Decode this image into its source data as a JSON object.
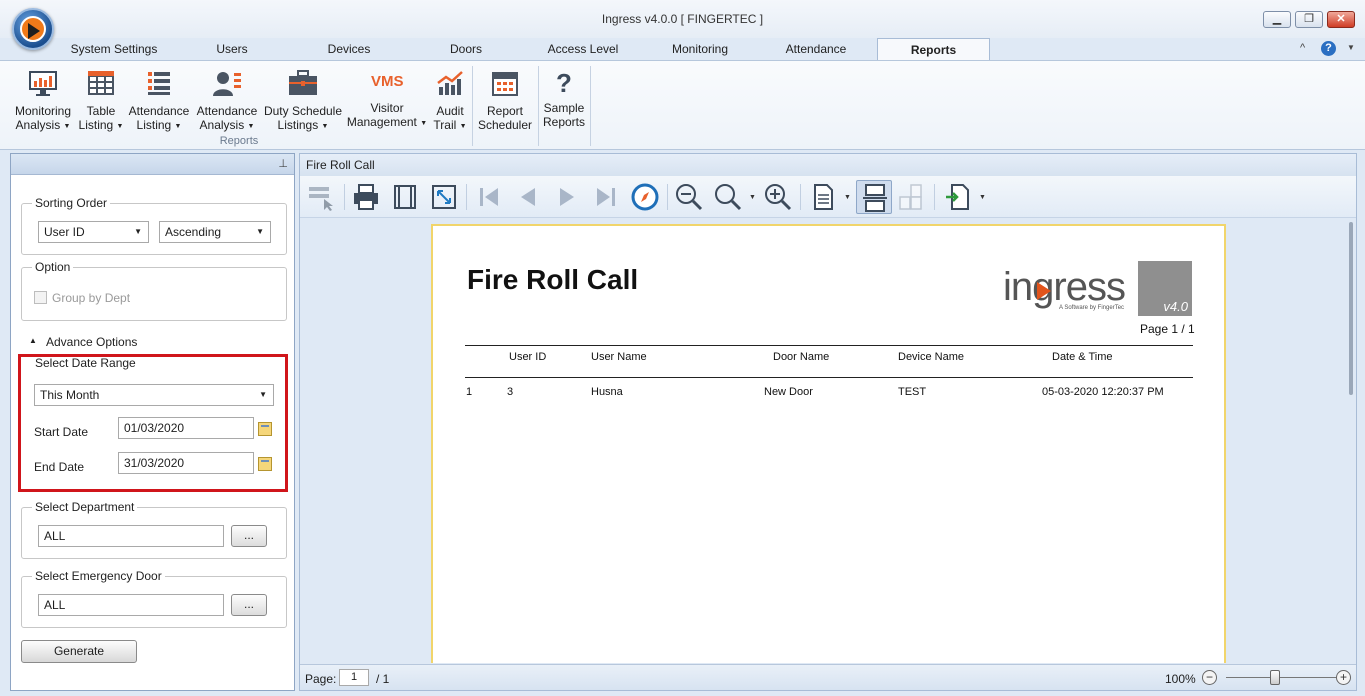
{
  "window": {
    "title": "Ingress v4.0.0 [ FINGERTEC ]",
    "minimize": "▁",
    "restore": "❐",
    "close": "✕"
  },
  "tabs": [
    "System Settings",
    "Users",
    "Devices",
    "Doors",
    "Access Level",
    "Monitoring",
    "Attendance",
    "Reports"
  ],
  "active_tab": "Reports",
  "help": {
    "collapse": "^",
    "help": "?",
    "more": "▼"
  },
  "ribbon": {
    "group_label": "Reports",
    "buttons": [
      {
        "line1": "Monitoring",
        "line2": "Analysis",
        "dropdown": true,
        "icon": "monitor-chart-icon"
      },
      {
        "line1": "Table",
        "line2": "Listing",
        "dropdown": true,
        "icon": "table-icon"
      },
      {
        "line1": "Attendance",
        "line2": "Listing",
        "dropdown": true,
        "icon": "list-icon"
      },
      {
        "line1": "Attendance",
        "line2": "Analysis",
        "dropdown": true,
        "icon": "user-analysis-icon"
      },
      {
        "line1": "Duty Schedule",
        "line2": "Listings",
        "dropdown": true,
        "icon": "briefcase-icon"
      },
      {
        "line1": "Visitor",
        "line2": "Management",
        "dropdown": true,
        "icon": "vms-icon",
        "icon_text": "VMS"
      },
      {
        "line1": "Audit",
        "line2": "Trail",
        "dropdown": true,
        "icon": "trend-chart-icon"
      },
      {
        "line1": "Report",
        "line2": "Scheduler",
        "dropdown": false,
        "icon": "calendar-icon"
      },
      {
        "line1": "Sample",
        "line2": "Reports",
        "dropdown": false,
        "icon": "question-icon",
        "icon_text": "?"
      }
    ]
  },
  "left_panel": {
    "pin": "📌",
    "sorting": {
      "legend": "Sorting Order",
      "field": "User ID",
      "order": "Ascending"
    },
    "option": {
      "legend": "Option",
      "group_by_dept": "Group by Dept",
      "group_by_dept_checked": false
    },
    "advance_toggle": "Advance Options",
    "date_range": {
      "legend": "Select Date Range",
      "preset": "This Month",
      "start_label": "Start Date",
      "start_value": "01/03/2020",
      "end_label": "End Date",
      "end_value": "31/03/2020"
    },
    "department": {
      "legend": "Select Department",
      "value": "ALL",
      "browse": "..."
    },
    "emergency_door": {
      "legend": "Select Emergency Door",
      "value": "ALL",
      "browse": "..."
    },
    "generate": "Generate"
  },
  "viewer": {
    "title": "Fire Roll Call",
    "report": {
      "heading": "Fire Roll Call",
      "logo_text": "ingress",
      "logo_tagline": "A Software by FingerTec",
      "logo_version": "v4.0",
      "page_counter": "Page 1 / 1",
      "columns": [
        "",
        "User ID",
        "User Name",
        "Door Name",
        "Device Name",
        "Date & Time"
      ],
      "rows": [
        [
          "1",
          "3",
          "Husna",
          "New Door",
          "TEST",
          "05-03-2020 12:20:37 PM"
        ]
      ]
    },
    "status": {
      "page_label": "Page:",
      "page_value": "1",
      "page_total": "/ 1",
      "zoom": "100%",
      "zoom_out": "−",
      "zoom_in": "+",
      "zoom_level": 0.5
    }
  }
}
